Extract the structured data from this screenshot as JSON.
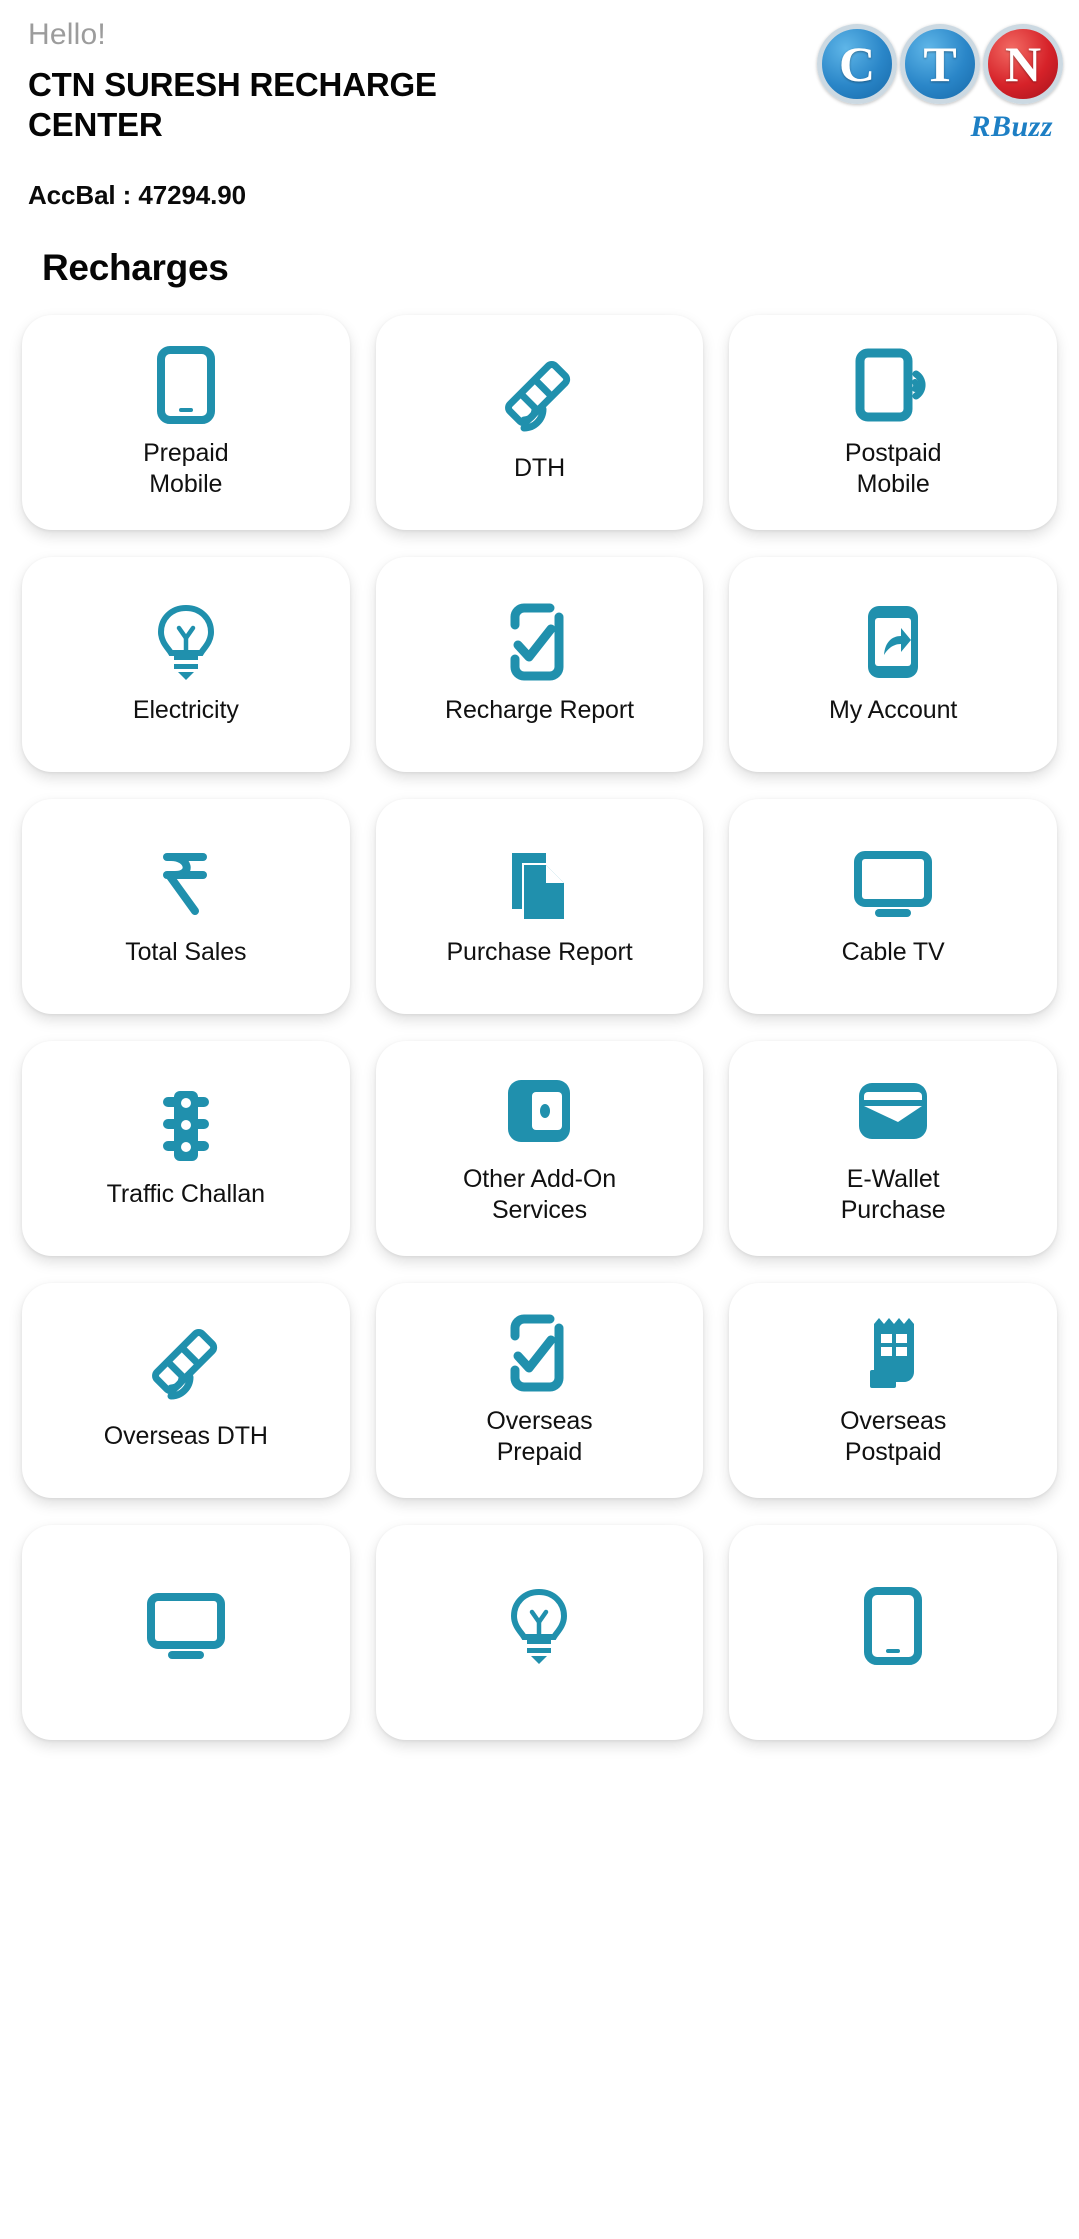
{
  "header": {
    "greeting": "Hello!",
    "shop_title": "CTN SURESH RECHARGE CENTER",
    "balance": "AccBal : 47294.90"
  },
  "logo": {
    "letters": [
      "C",
      "T",
      "N"
    ],
    "subtitle": "RBuzz",
    "colors": {
      "blue": "#2a86c8",
      "red": "#d62229",
      "sub": "#1d7fc4"
    }
  },
  "section": {
    "title": "Recharges"
  },
  "theme": {
    "accent": "#2090ad",
    "background": "#ffffff",
    "tile_background": "#ffffff",
    "label_color": "#111111",
    "greeting_color": "#9c9c9c"
  },
  "tiles": [
    {
      "label": "Prepaid\nMobile",
      "icon": "smartphone-icon"
    },
    {
      "label": "DTH",
      "icon": "satellite-icon"
    },
    {
      "label": "Postpaid\nMobile",
      "icon": "smartphone-signal-icon"
    },
    {
      "label": "Electricity",
      "icon": "lightbulb-icon"
    },
    {
      "label": "Recharge Report",
      "icon": "phone-check-icon"
    },
    {
      "label": "My Account",
      "icon": "phone-share-icon"
    },
    {
      "label": "Total Sales",
      "icon": "rupee-icon"
    },
    {
      "label": "Purchase Report",
      "icon": "documents-icon"
    },
    {
      "label": "Cable TV",
      "icon": "monitor-icon"
    },
    {
      "label": "Traffic Challan",
      "icon": "traffic-light-icon"
    },
    {
      "label": "Other Add-On\nServices",
      "icon": "wallet-icon"
    },
    {
      "label": "E-Wallet\nPurchase",
      "icon": "card-wallet-icon"
    },
    {
      "label": "Overseas DTH",
      "icon": "satellite-icon"
    },
    {
      "label": "Overseas\nPrepaid",
      "icon": "phone-check-icon"
    },
    {
      "label": "Overseas\nPostpaid",
      "icon": "receipt-icon"
    },
    {
      "label": "",
      "icon": "monitor-icon"
    },
    {
      "label": "",
      "icon": "lightbulb-icon"
    },
    {
      "label": "",
      "icon": "smartphone-icon"
    }
  ]
}
